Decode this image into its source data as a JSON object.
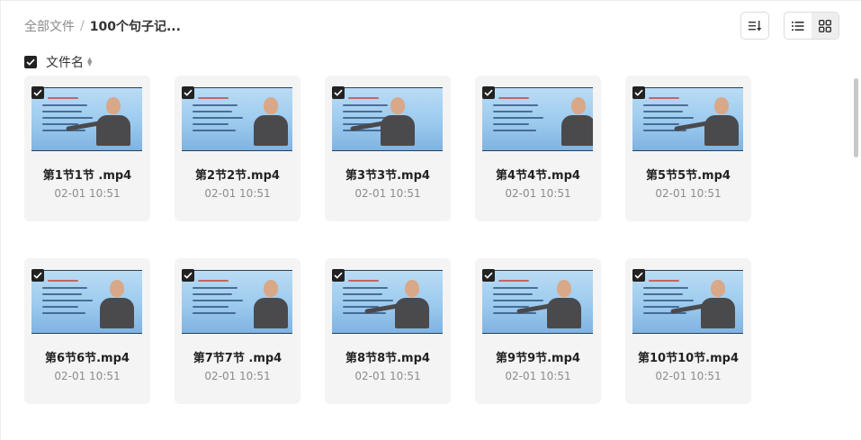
{
  "breadcrumb": {
    "root": "全部文件",
    "separator": "/",
    "current": "100个句子记..."
  },
  "toolbar": {
    "sort_icon": "sort-descending-icon",
    "list_view_icon": "list-view-icon",
    "grid_view_icon": "grid-view-icon",
    "active_view": "grid"
  },
  "list_header": {
    "column_label": "文件名",
    "all_selected": true
  },
  "colors": {
    "accent_dark": "#222222",
    "card_bg": "#f4f4f4",
    "thumb_blue": "#9ccaee"
  },
  "files": [
    {
      "name": "第1节1节 .mp4",
      "date": "02-01 10:51",
      "selected": true
    },
    {
      "name": "第2节2节.mp4",
      "date": "02-01 10:51",
      "selected": true
    },
    {
      "name": "第3节3节.mp4",
      "date": "02-01 10:51",
      "selected": true
    },
    {
      "name": "第4节4节.mp4",
      "date": "02-01 10:51",
      "selected": true
    },
    {
      "name": "第5节5节.mp4",
      "date": "02-01 10:51",
      "selected": true
    },
    {
      "name": "第6节6节.mp4",
      "date": "02-01 10:51",
      "selected": true
    },
    {
      "name": "第7节7节 .mp4",
      "date": "02-01 10:51",
      "selected": true
    },
    {
      "name": "第8节8节.mp4",
      "date": "02-01 10:51",
      "selected": true
    },
    {
      "name": "第9节9节.mp4",
      "date": "02-01 10:51",
      "selected": true
    },
    {
      "name": "第10节10节.mp4",
      "date": "02-01 10:51",
      "selected": true
    }
  ]
}
